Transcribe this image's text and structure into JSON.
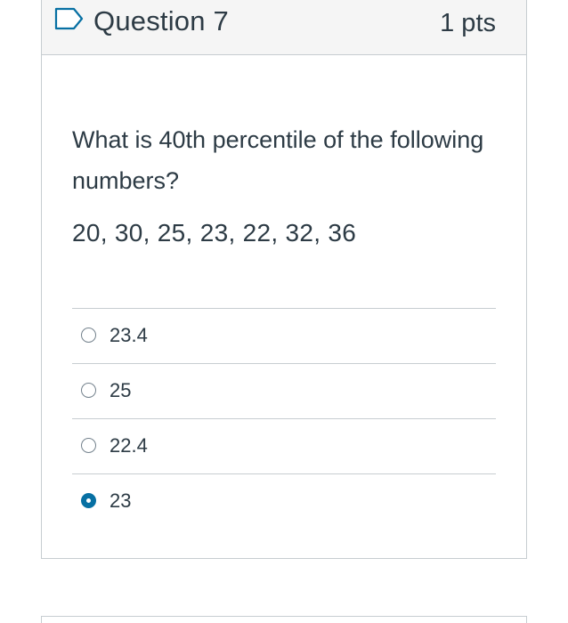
{
  "question": {
    "title": "Question 7",
    "points": "1 pts",
    "text": "What is 40th percentile of the following numbers?",
    "numbers": "20, 30, 25, 23, 22, 32, 36",
    "flag_icon": "flag-outline-icon"
  },
  "answers": [
    {
      "label": "23.4",
      "selected": false
    },
    {
      "label": "25",
      "selected": false
    },
    {
      "label": "22.4",
      "selected": false
    },
    {
      "label": "23",
      "selected": true
    }
  ],
  "colors": {
    "text": "#2d3b45",
    "border": "#c7cdd1",
    "header_bg": "#f5f5f5",
    "selected_radio": "#0770a3",
    "flag": "#0770a3"
  }
}
